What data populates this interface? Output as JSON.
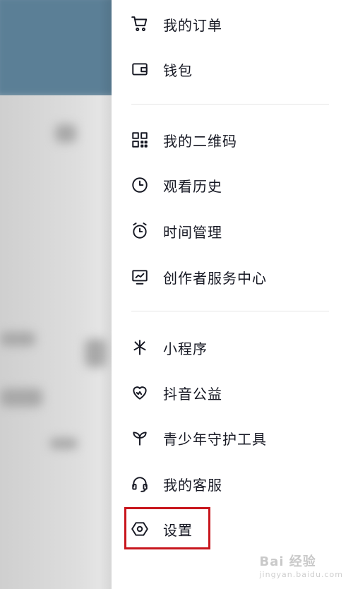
{
  "menu": {
    "orders": "我的订单",
    "wallet": "钱包",
    "qrcode": "我的二维码",
    "history": "观看历史",
    "time_mgmt": "时间管理",
    "creator_center": "创作者服务中心",
    "mini_programs": "小程序",
    "charity": "抖音公益",
    "youth_protection": "青少年守护工具",
    "customer_service": "我的客服",
    "settings": "设置"
  },
  "watermark": {
    "brand": "Bai 经验",
    "url": "jingyan.baidu.com"
  },
  "colors": {
    "highlight_border": "#c8161d",
    "text": "#161823",
    "divider": "#e6e6e6"
  },
  "icons": [
    "cart-icon",
    "wallet-icon",
    "qrcode-icon",
    "clock-icon",
    "alarm-icon",
    "chart-icon",
    "mini-program-icon",
    "heart-icon",
    "sprout-icon",
    "headset-icon",
    "hexagon-settings-icon"
  ]
}
